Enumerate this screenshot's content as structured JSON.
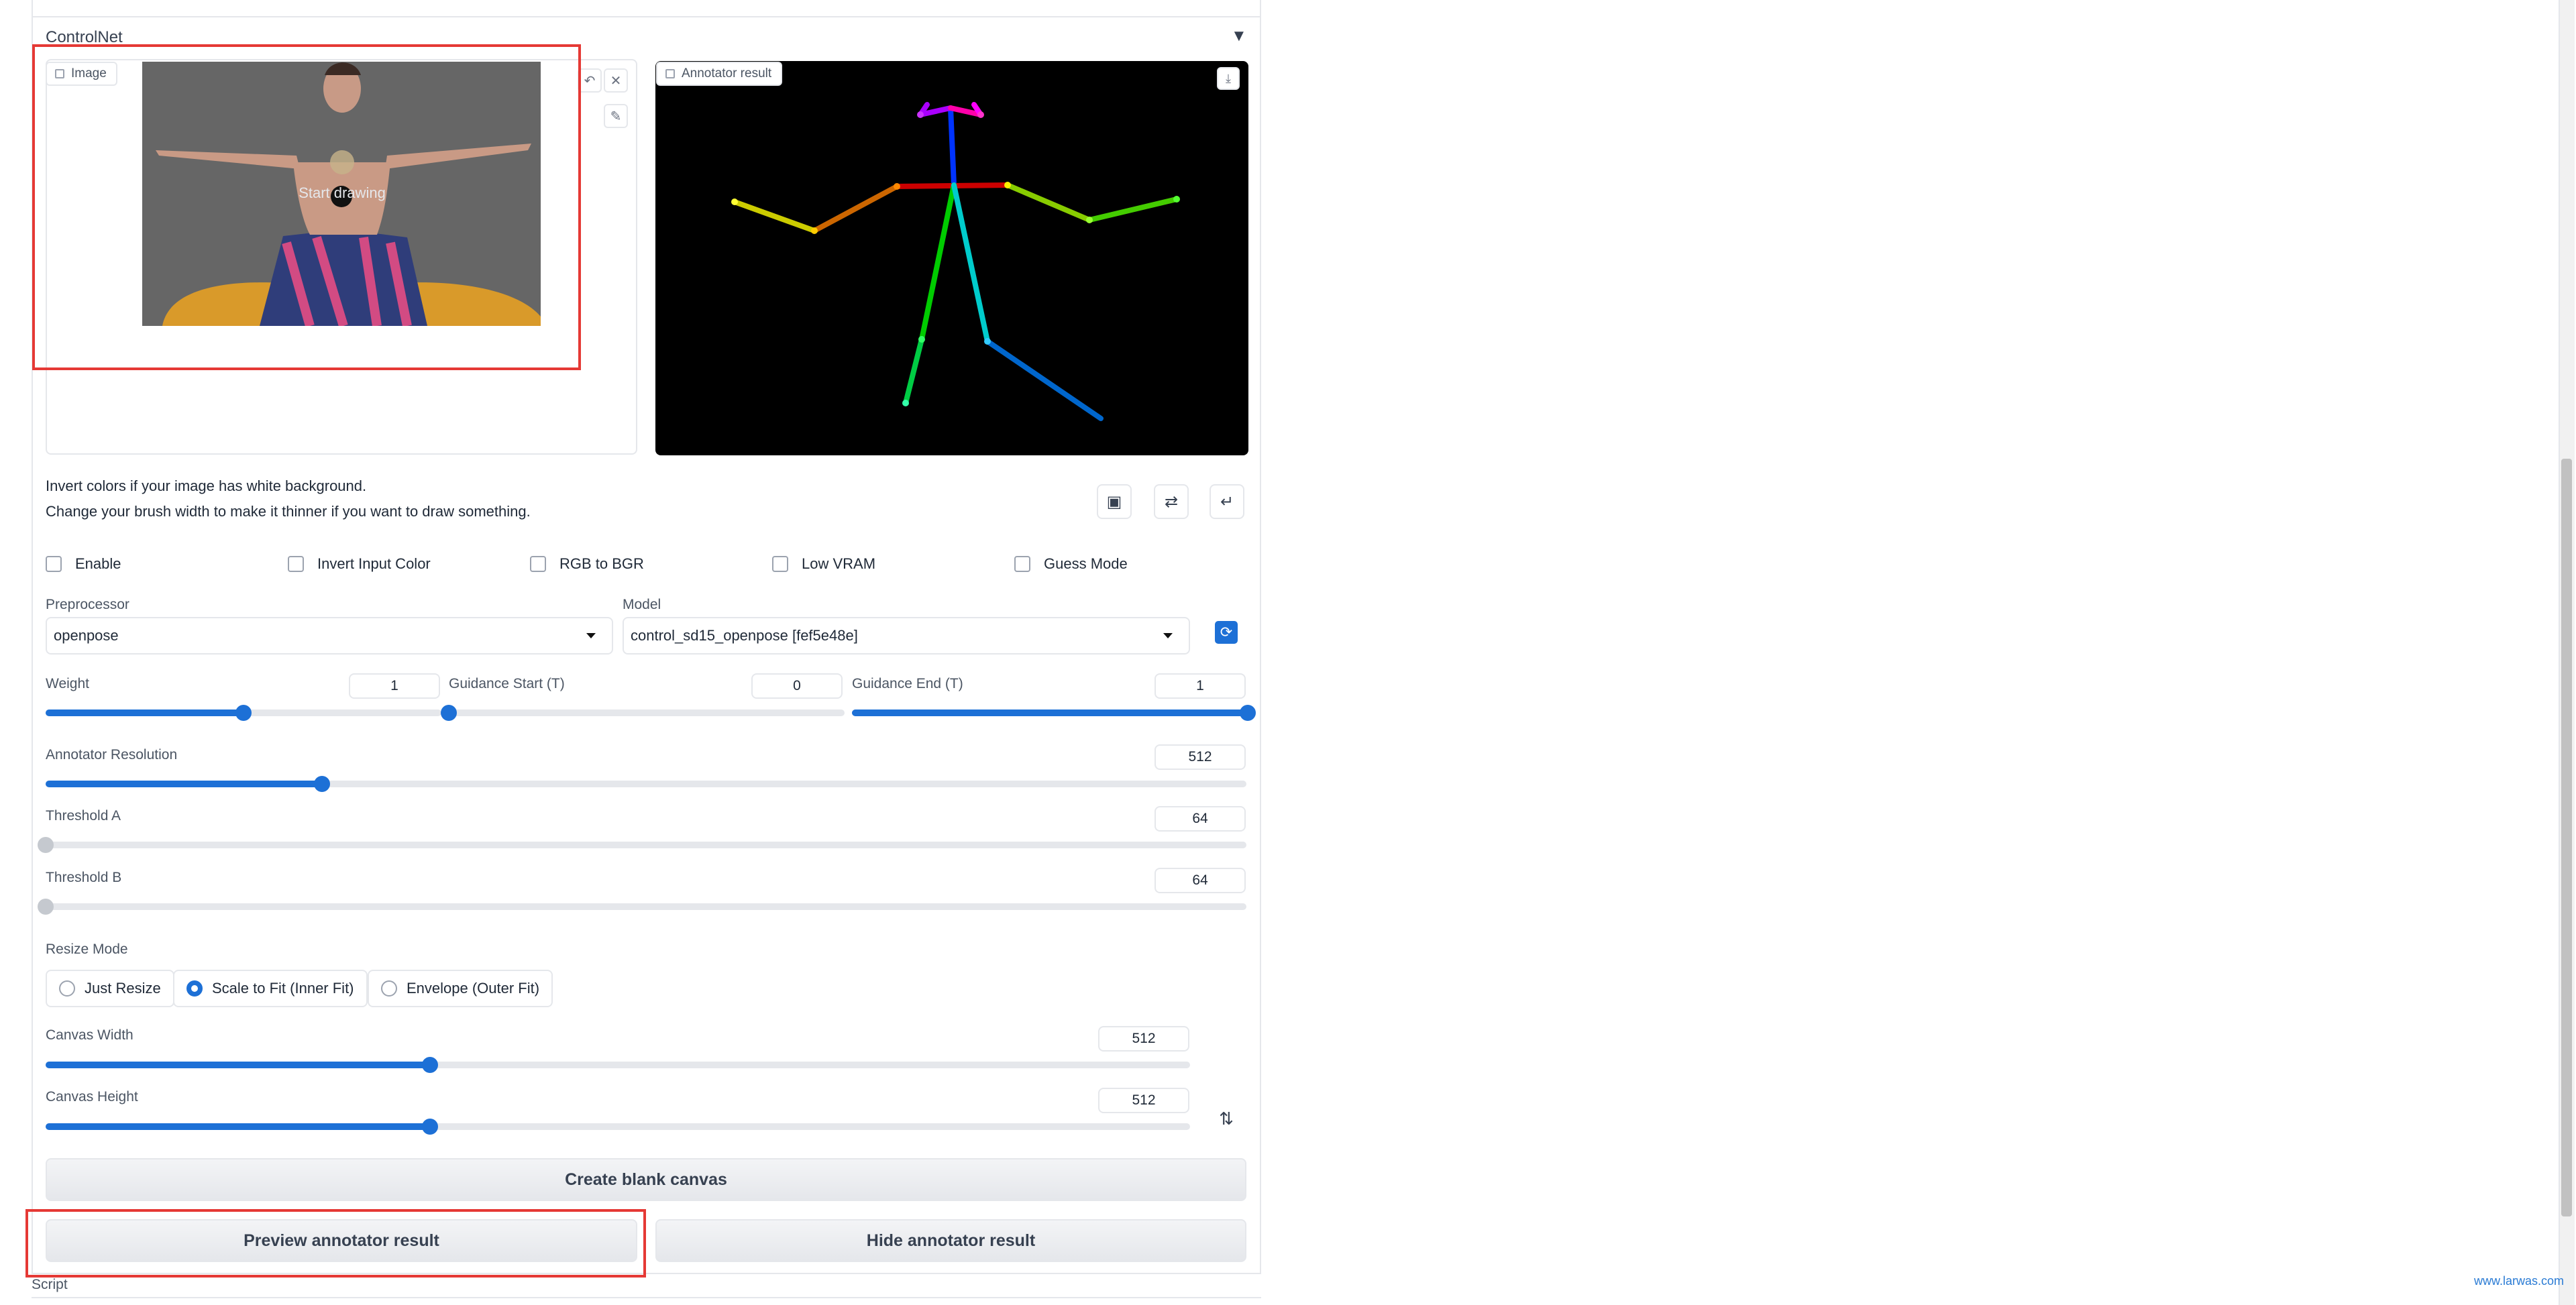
{
  "section": {
    "title": "ControlNet",
    "collapse_glyph": "▼"
  },
  "image_panel": {
    "tag": "Image",
    "start_drawing": "Start drawing"
  },
  "annotator_panel": {
    "tag": "Annotator result"
  },
  "info": {
    "line1": "Invert colors if your image has white background.",
    "line2": "Change your brush width to make it thinner if you want to draw something."
  },
  "checkboxes": [
    {
      "label": "Enable",
      "checked": false
    },
    {
      "label": "Invert Input Color",
      "checked": false
    },
    {
      "label": "RGB to BGR",
      "checked": false
    },
    {
      "label": "Low VRAM",
      "checked": false
    },
    {
      "label": "Guess Mode",
      "checked": false
    }
  ],
  "preprocessor": {
    "label": "Preprocessor",
    "value": "openpose"
  },
  "model": {
    "label": "Model",
    "value": "control_sd15_openpose [fef5e48e]"
  },
  "weight": {
    "label": "Weight",
    "value": "1",
    "fraction": 0.5
  },
  "guidance_start": {
    "label": "Guidance Start (T)",
    "value": "0",
    "fraction": 0.0
  },
  "guidance_end": {
    "label": "Guidance End (T)",
    "value": "1",
    "fraction": 1.0
  },
  "annotator_resolution": {
    "label": "Annotator Resolution",
    "value": "512",
    "fraction": 0.23
  },
  "threshold_a": {
    "label": "Threshold A",
    "value": "64",
    "fraction": 0.0
  },
  "threshold_b": {
    "label": "Threshold B",
    "value": "64",
    "fraction": 0.0
  },
  "resize_mode": {
    "label": "Resize Mode",
    "options": [
      "Just Resize",
      "Scale to Fit (Inner Fit)",
      "Envelope (Outer Fit)"
    ],
    "selected": "Scale to Fit (Inner Fit)"
  },
  "canvas_width": {
    "label": "Canvas Width",
    "value": "512",
    "fraction": 0.336
  },
  "canvas_height": {
    "label": "Canvas Height",
    "value": "512",
    "fraction": 0.336
  },
  "buttons": {
    "create_blank": "Create blank canvas",
    "preview": "Preview annotator result",
    "hide": "Hide annotator result"
  },
  "script": {
    "label": "Script"
  },
  "watermark": "www.larwas.com",
  "colors": {
    "accent": "#1d70d6",
    "highlight": "#e53935"
  },
  "icons": [
    "image-icon",
    "undo-icon",
    "close-icon",
    "brush-icon",
    "download-icon",
    "camera-icon",
    "swap-icon",
    "send-icon",
    "refresh-icon",
    "swap-vertical-icon"
  ]
}
